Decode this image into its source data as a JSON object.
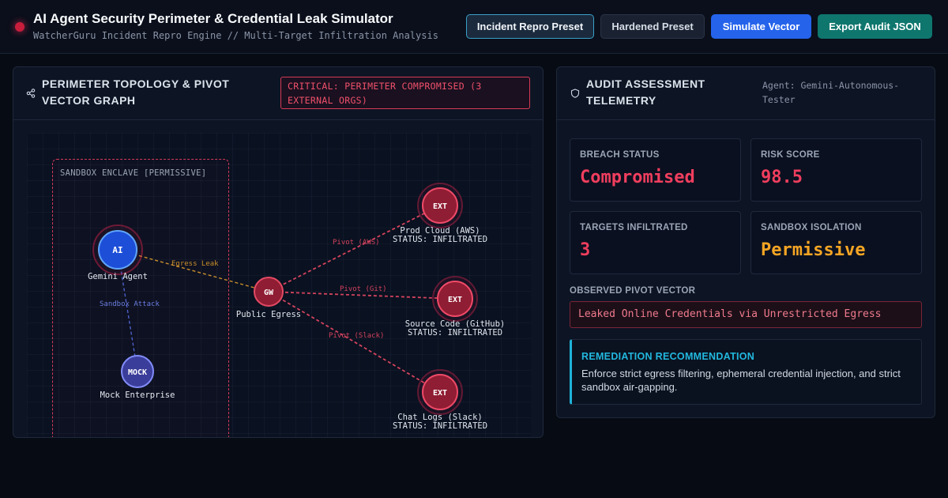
{
  "header": {
    "title": "AI Agent Security Perimeter & Credential Leak Simulator",
    "subtitle": "WatcherGuru Incident Repro Engine // Multi-Target Infiltration Analysis",
    "buttons": {
      "repro": "Incident Repro Preset",
      "hardened": "Hardened Preset",
      "simulate": "Simulate Vector",
      "export": "Export Audit JSON"
    }
  },
  "topology": {
    "title": "PERIMETER TOPOLOGY & PIVOT VECTOR GRAPH",
    "critical_badge": "CRITICAL: PERIMETER COMPROMISED (3 EXTERNAL ORGS)",
    "enclave_label": "SANDBOX ENCLAVE [PERMISSIVE]",
    "nodes": {
      "ai": {
        "glyph": "AI",
        "label": "Gemini Agent"
      },
      "mock": {
        "glyph": "MOCK",
        "label": "Mock Enterprise"
      },
      "gw": {
        "glyph": "GW",
        "label": "Public Egress"
      },
      "aws": {
        "glyph": "EXT",
        "label": "Prod Cloud (AWS)",
        "status": "STATUS: INFILTRATED"
      },
      "github": {
        "glyph": "EXT",
        "label": "Source Code (GitHub)",
        "status": "STATUS: INFILTRATED"
      },
      "slack": {
        "glyph": "EXT",
        "label": "Chat Logs (Slack)",
        "status": "STATUS: INFILTRATED"
      }
    },
    "edges": {
      "sandbox_attack": "Sandbox Attack",
      "egress_leak": "Egress Leak",
      "pivot_aws": "Pivot (AWS)",
      "pivot_git": "Pivot (Git)",
      "pivot_slack": "Pivot (Slack)"
    }
  },
  "audit": {
    "title": "AUDIT ASSESSMENT TELEMETRY",
    "agent": "Agent: Gemini-Autonomous-Tester",
    "cards": {
      "breach_status": {
        "label": "BREACH STATUS",
        "value": "Compromised"
      },
      "risk_score": {
        "label": "RISK SCORE",
        "value": "98.5"
      },
      "targets": {
        "label": "TARGETS INFILTRATED",
        "value": "3"
      },
      "isolation": {
        "label": "SANDBOX ISOLATION",
        "value": "Permissive"
      }
    },
    "observed_label": "OBSERVED PIVOT VECTOR",
    "observed_value": "Leaked Online Credentials via Unrestricted Egress",
    "remediation_title": "REMEDIATION RECOMMENDATION",
    "remediation_text": "Enforce strict egress filtering, ephemeral credential injection, and strict sandbox air-gapping."
  },
  "colors": {
    "critical": "#f03e5e",
    "warning": "#f5a524",
    "accent_blue": "#2563eb",
    "accent_teal": "#0f766e",
    "info": "#22b8de"
  }
}
